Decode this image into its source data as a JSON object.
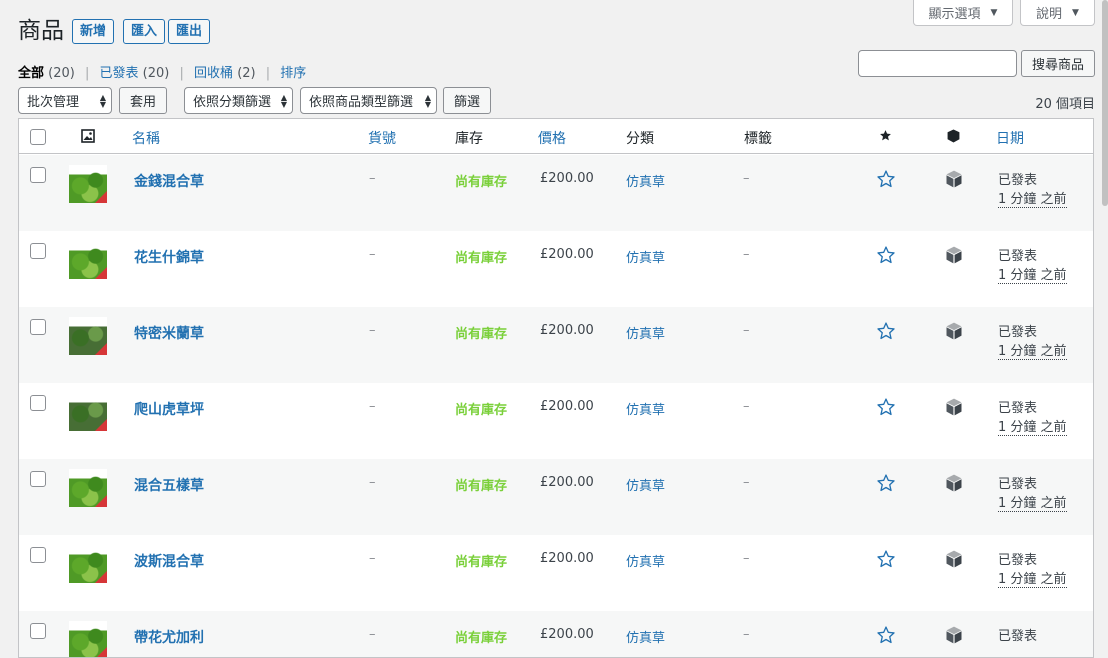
{
  "header": {
    "title": "商品",
    "buttons": [
      "新增",
      "匯入",
      "匯出"
    ],
    "screen_options": "顯示選項",
    "help": "說明"
  },
  "views": [
    {
      "label": "全部",
      "count": "(20)",
      "current": true
    },
    {
      "label": "已發表",
      "count": "(20)"
    },
    {
      "label": "回收桶",
      "count": "(2)"
    },
    {
      "label": "排序",
      "count": ""
    }
  ],
  "search": {
    "button": "搜尋商品",
    "value": ""
  },
  "filters": {
    "bulk": "批次管理",
    "apply": "套用",
    "category": "依照分類篩選",
    "type": "依照商品類型篩選",
    "filter": "篩選"
  },
  "items_count": "20 個項目",
  "table": {
    "columns": {
      "name": "名稱",
      "sku": "貨號",
      "stock": "庫存",
      "price": "價格",
      "categories": "分類",
      "tags": "標籤",
      "date": "日期"
    },
    "rows": [
      {
        "name": "金錢混合草",
        "sku": "–",
        "stock": "尚有庫存",
        "price": "£200.00",
        "category": "仿真草",
        "tags": "–",
        "status": "已發表",
        "time": "1 分鐘 之前"
      },
      {
        "name": "花生什錦草",
        "sku": "–",
        "stock": "尚有庫存",
        "price": "£200.00",
        "category": "仿真草",
        "tags": "–",
        "status": "已發表",
        "time": "1 分鐘 之前"
      },
      {
        "name": "特密米蘭草",
        "sku": "–",
        "stock": "尚有庫存",
        "price": "£200.00",
        "category": "仿真草",
        "tags": "–",
        "status": "已發表",
        "time": "1 分鐘 之前"
      },
      {
        "name": "爬山虎草坪",
        "sku": "–",
        "stock": "尚有庫存",
        "price": "£200.00",
        "category": "仿真草",
        "tags": "–",
        "status": "已發表",
        "time": "1 分鐘 之前"
      },
      {
        "name": "混合五樣草",
        "sku": "–",
        "stock": "尚有庫存",
        "price": "£200.00",
        "category": "仿真草",
        "tags": "–",
        "status": "已發表",
        "time": "1 分鐘 之前"
      },
      {
        "name": "波斯混合草",
        "sku": "–",
        "stock": "尚有庫存",
        "price": "£200.00",
        "category": "仿真草",
        "tags": "–",
        "status": "已發表",
        "time": "1 分鐘 之前"
      },
      {
        "name": "帶花尤加利",
        "sku": "–",
        "stock": "尚有庫存",
        "price": "£200.00",
        "category": "仿真草",
        "tags": "–",
        "status": "已發表",
        "time": ""
      }
    ]
  },
  "colors": {
    "link": "#2271b1",
    "in_stock": "#7ad03a"
  }
}
